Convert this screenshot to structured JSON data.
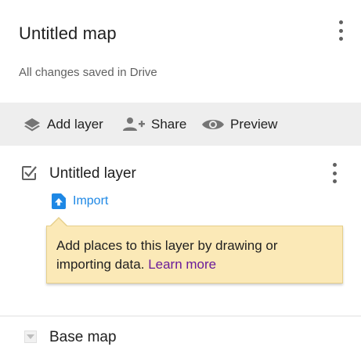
{
  "header": {
    "title": "Untitled map",
    "save_status": "All changes saved in Drive",
    "menu_icon": "more-vert-icon"
  },
  "toolbar": {
    "add_layer": {
      "label": "Add layer",
      "icon": "layers-icon"
    },
    "share": {
      "label": "Share",
      "icon": "person-add-icon"
    },
    "preview": {
      "label": "Preview",
      "icon": "eye-icon"
    }
  },
  "layer": {
    "name": "Untitled layer",
    "checked": true,
    "import_label": "Import",
    "import_icon": "upload-file-icon",
    "menu_icon": "more-vert-icon"
  },
  "tooltip": {
    "text": "Add places to this layer by drawing or importing data.",
    "link": "Learn more"
  },
  "base_map": {
    "label": "Base map",
    "toggle_icon": "triangle-down-icon"
  },
  "colors": {
    "toolbar_bg": "#eeeeee",
    "link_blue": "#1e88e5",
    "learn_more_purple": "#6a1b9a",
    "tooltip_bg": "#fbe9b7"
  }
}
